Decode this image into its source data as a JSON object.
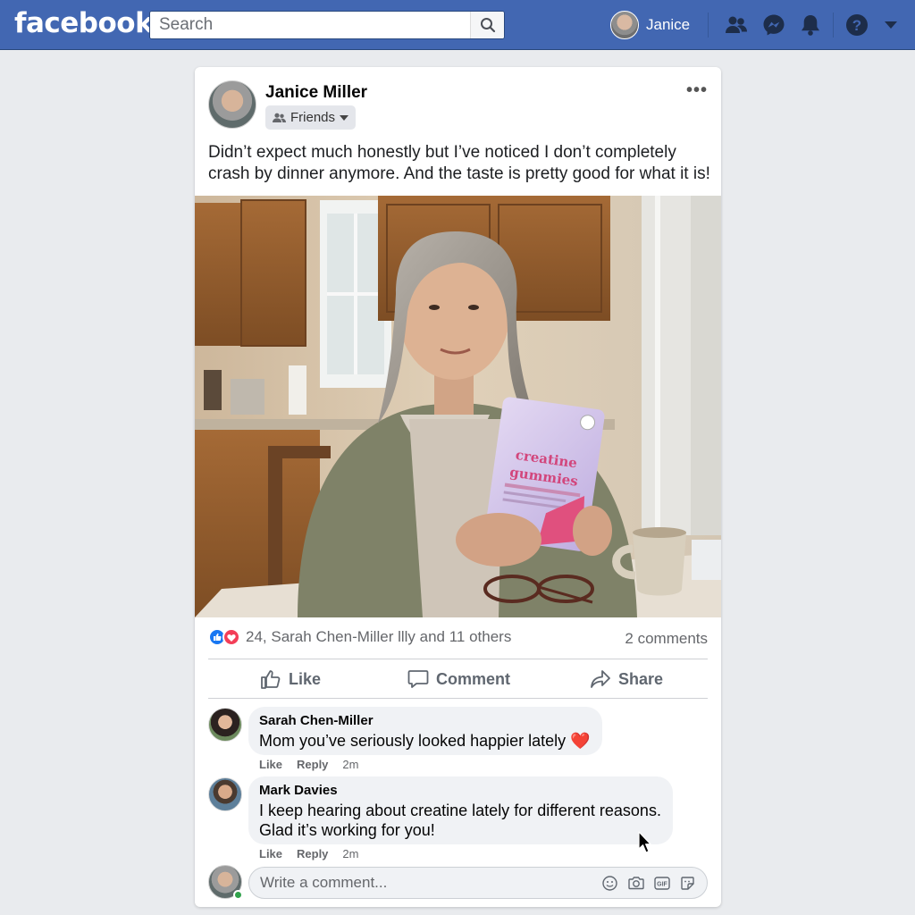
{
  "header": {
    "logo": "facebook",
    "search_placeholder": "Search",
    "profile_name": "Janice",
    "brand_color": "#4267b2"
  },
  "post": {
    "author": "Janice Miller",
    "audience": "Friends",
    "text": "Didn’t expect much honestly but I’ve noticed I don’t completely crash by dinner anymore. And the taste is pretty good for what it is!",
    "photo": {
      "product_label_line1": "creatine",
      "product_label_line2": "gummies"
    },
    "reactions_text": "24, Sarah Chen-Miller llly and 11 others",
    "comments_count_text": "2 comments",
    "actions": {
      "like": "Like",
      "comment": "Comment",
      "share": "Share"
    }
  },
  "comments": [
    {
      "author": "Sarah Chen-Miller",
      "text": "Mom you’ve seriously looked happier lately",
      "emoji": "❤️",
      "like": "Like",
      "reply": "Reply",
      "time": "2m"
    },
    {
      "author": "Mark Davies",
      "text_line1": "I keep hearing about creatine lately for different reasons.",
      "text_line2": "Glad it’s working for you!",
      "like": "Like",
      "reply": "Reply",
      "time": "2m"
    }
  ],
  "composer": {
    "placeholder": "Write a comment...",
    "icons": [
      "emoji-icon",
      "camera-icon",
      "gif-icon",
      "sticker-icon"
    ]
  }
}
